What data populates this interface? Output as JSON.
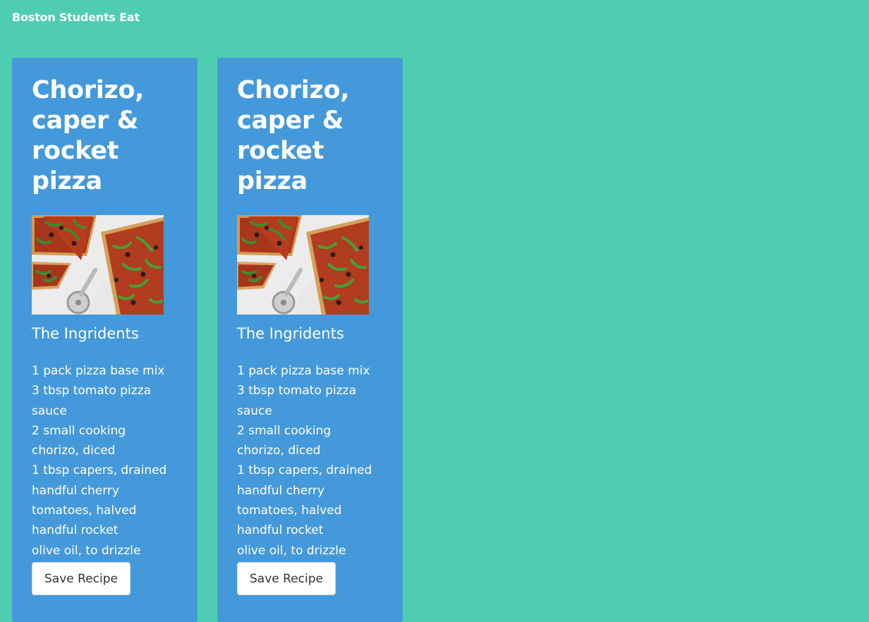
{
  "header": {
    "brand": "Boston Students Eat"
  },
  "recipes": [
    {
      "title": "Chorizo, caper & rocket pizza",
      "image_icon": "pizza-photo",
      "ingredients_heading": "The Ingridents",
      "ingredients": [
        "1 pack pizza base mix",
        "3 tbsp tomato pizza sauce",
        "2 small cooking chorizo, diced",
        "1 tbsp capers, drained",
        "handful cherry tomatoes, halved",
        "handful rocket",
        "olive oil, to drizzle"
      ],
      "save_label": "Save Recipe"
    },
    {
      "title": "Chorizo, caper & rocket pizza",
      "image_icon": "pizza-photo",
      "ingredients_heading": "The Ingridents",
      "ingredients": [
        "1 pack pizza base mix",
        "3 tbsp tomato pizza sauce",
        "2 small cooking chorizo, diced",
        "1 tbsp capers, drained",
        "handful cherry tomatoes, halved",
        "handful rocket",
        "olive oil, to drizzle"
      ],
      "save_label": "Save Recipe"
    }
  ],
  "colors": {
    "page_background": "#4ecdb1",
    "card_background": "#4499da",
    "button_background": "#ffffff"
  }
}
